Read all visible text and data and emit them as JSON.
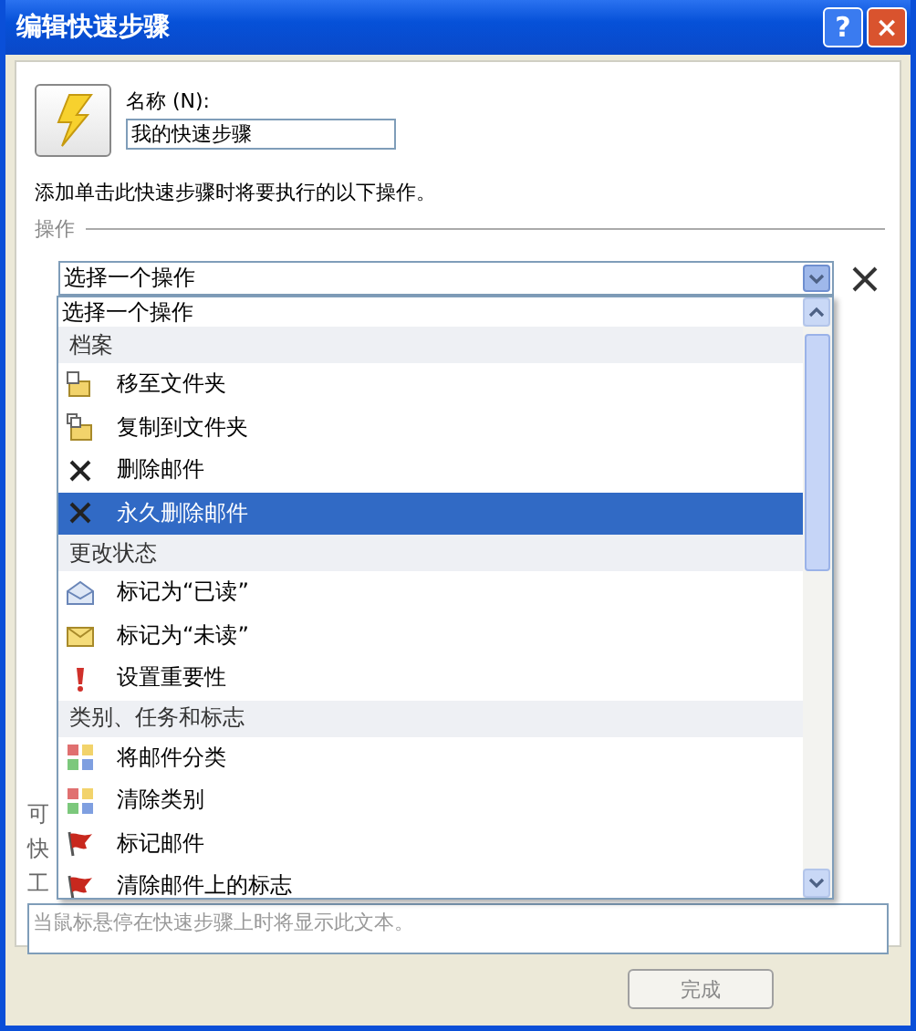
{
  "window": {
    "title": "编辑快速步骤",
    "buttons": [
      {
        "kind": "help",
        "label": "?"
      },
      {
        "kind": "close",
        "label": "×"
      }
    ]
  },
  "name_field": {
    "label": "名称 (N):",
    "value": "我的快速步骤"
  },
  "instruction": "添加单击此快速步骤时将要执行的以下操作。",
  "actions_section": {
    "heading": "操作"
  },
  "action_select": {
    "value": "选择一个操作",
    "expanded": true
  },
  "dropdown": {
    "items": [
      {
        "kind": "plain",
        "label": "选择一个操作",
        "selected": false
      },
      {
        "kind": "group",
        "label": "档案"
      },
      {
        "kind": "move",
        "label": "移至文件夹",
        "selected": false
      },
      {
        "kind": "copy",
        "label": "复制到文件夹",
        "selected": false
      },
      {
        "kind": "delete",
        "label": "删除邮件",
        "selected": false
      },
      {
        "kind": "delete",
        "label": "永久删除邮件",
        "selected": true
      },
      {
        "kind": "group",
        "label": "更改状态"
      },
      {
        "kind": "read",
        "label": "标记为“已读”",
        "selected": false
      },
      {
        "kind": "unread",
        "label": "标记为“未读”",
        "selected": false
      },
      {
        "kind": "importance",
        "label": "设置重要性",
        "selected": false
      },
      {
        "kind": "group",
        "label": "类别、任务和标志"
      },
      {
        "kind": "category",
        "label": "将邮件分类",
        "selected": false
      },
      {
        "kind": "category",
        "label": "清除类别",
        "selected": false
      },
      {
        "kind": "flag",
        "label": "标记邮件",
        "selected": false
      },
      {
        "kind": "flag",
        "label": "清除邮件上的标志",
        "selected": false
      }
    ]
  },
  "hidden_labels": [
    "可",
    "快",
    "工"
  ],
  "description_field": {
    "placeholder": "当鼠标悬停在快速步骤上时将显示此文本。"
  },
  "footer_buttons": [
    "完成"
  ]
}
